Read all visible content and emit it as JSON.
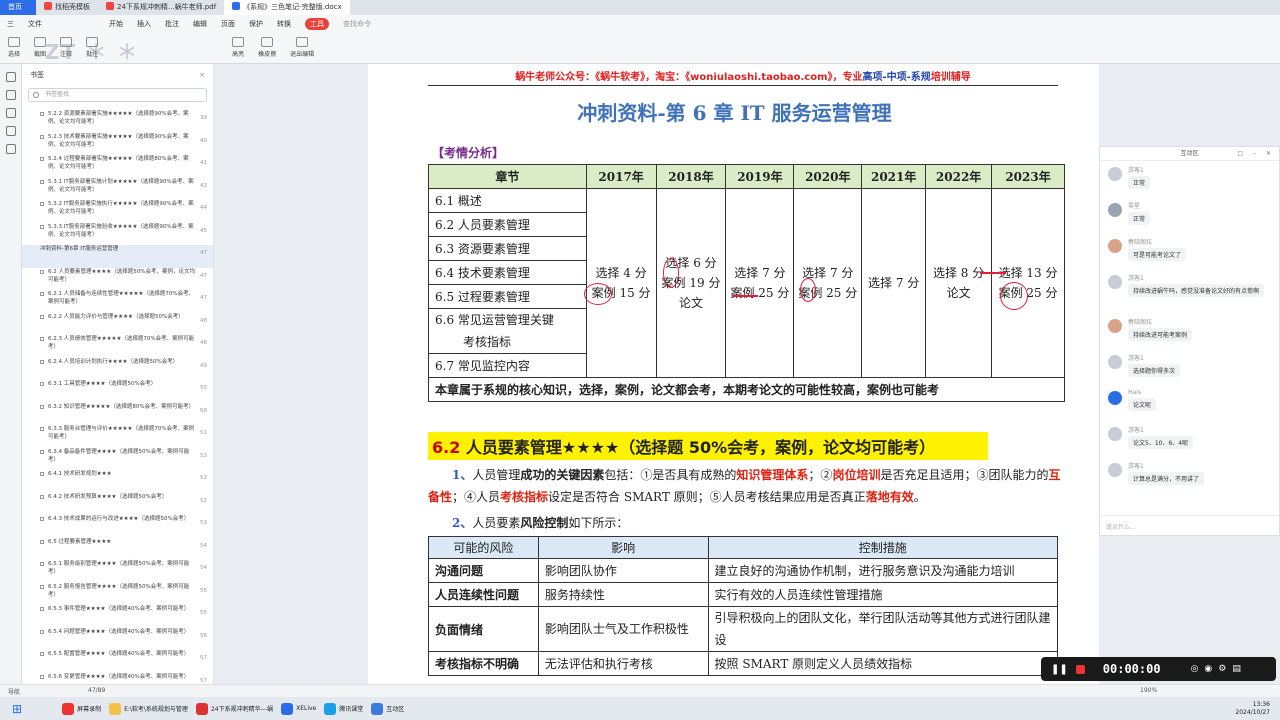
{
  "tabs": [
    "首页",
    "找稻壳模板",
    "24下系规冲刺精...蜗牛老师.pdf",
    "《系规》三色笔记-完整版.docx"
  ],
  "menu": [
    "三",
    "文件",
    "开始",
    "插入",
    "批注",
    "编辑",
    "页面",
    "保护",
    "转换",
    "工具"
  ],
  "menu_search": "查找命令",
  "ribbon": [
    "选择",
    "截图",
    "注释",
    "批注",
    "高亮",
    "橡皮擦",
    "退出编辑"
  ],
  "sidebar": {
    "title": "书签",
    "search_placeholder": "书签查找",
    "items": [
      {
        "label": "5.2.2 资源要素部署实施★★★★★（选择题90%会考、案例、论文均可能考）",
        "page": "39"
      },
      {
        "label": "5.2.3 技术要素部署实施★★★★★（选择题90%会考、案例、论文均可能考）",
        "page": "40"
      },
      {
        "label": "5.2.4 过程要素部署实施★★★★★（选择题80%会考、案例、论文均可能考）",
        "page": "41"
      },
      {
        "label": "5.3.1 IT服务部署实施计划★★★★★（选择题90%会考、案例、论文均可能考）",
        "page": "43"
      },
      {
        "label": "5.3.2 IT服务部署实施执行★★★★★（选择题90%会考、案例、论文均可能考）",
        "page": "44"
      },
      {
        "label": "5.3.3 IT服务部署实施验收★★★★★（选择题90%会考、案例、论文均可能考）",
        "page": "45"
      },
      {
        "label": "冲刺资料-第6章 IT服务运营管理",
        "page": "47",
        "active": true
      },
      {
        "label": "6.2 人员要素管理★★★★（选择题50%会考，案例，论文均可能考）",
        "page": "47"
      },
      {
        "label": "6.2.1 人员储备与连续性管理★★★★★（选择题70%会考、案例可能考）",
        "page": "47"
      },
      {
        "label": "6.2.2 人员能力评价与管理★★★★（选择题50%会考）",
        "page": "48"
      },
      {
        "label": "6.2.3 人员绩效管理★★★★★（选择题70%会考、案例可能考）",
        "page": "48"
      },
      {
        "label": "6.2.4 人员培训计划执行★★★★（选择题50%会考）",
        "page": "49"
      },
      {
        "label": "6.3.1 工具管理★★★★（选择题50%会考）",
        "page": "50"
      },
      {
        "label": "6.3.2 知识管理★★★★★（选择题80%会考、案例可能考）",
        "page": "50"
      },
      {
        "label": "6.3.3 服务台管理与评价★★★★★（选择题70%会考、案例可能考）",
        "page": "51"
      },
      {
        "label": "6.3.4 备品备件管理★★★★（选择题50%会考、案例可能考）",
        "page": "52"
      },
      {
        "label": "6.4.1 技术研发规划★★★",
        "page": "52"
      },
      {
        "label": "6.4.2 技术研发预算★★★★（选择题50%会考）",
        "page": "52"
      },
      {
        "label": "6.4.3 技术成果的运行与改进★★★★（选择题50%会考）",
        "page": "53"
      },
      {
        "label": "6.5 过程要素管理★★★★",
        "page": "54"
      },
      {
        "label": "6.5.1 服务级别管理★★★★（选择题50%会考、案例可能考）",
        "page": "54"
      },
      {
        "label": "6.5.2 服务报告管理★★★★（选择题50%会考、案例可能考）",
        "page": "55"
      },
      {
        "label": "6.5.3 事件管理★★★★（选择题40%会考、案例可能考）",
        "page": "55"
      },
      {
        "label": "6.5.4 问题管理★★★★（选择题40%会考、案例可能考）",
        "page": "56"
      },
      {
        "label": "6.5.5 配置管理★★★★（选择题40%会考、案例可能考）",
        "page": "57"
      },
      {
        "label": "6.5.6 变更管理★★★★（选择题40%会考、案例可能考）",
        "page": "57"
      }
    ]
  },
  "doc": {
    "header_red": "蜗牛老师公众号：《蜗牛软考》，淘宝：《woniulaoshi.taobao.com》，专业",
    "header_blue": "高项-中项-系规",
    "header_tail": "培训辅导",
    "title": "冲刺资料-第 6 章  IT 服务运营管理",
    "section_label": "【考情分析】",
    "table1": {
      "headers": [
        "章节",
        "2017年",
        "2018年",
        "2019年",
        "2020年",
        "2021年",
        "2022年",
        "2023年"
      ],
      "chapters": [
        "6.1 概述",
        "6.2 人员要素管理",
        "6.3 资源要素管理",
        "6.4 技术要素管理",
        "6.5 过程要素管理",
        "6.6 常见运营管理关键",
        "考核指标",
        "6.7 常见监控内容"
      ],
      "years": [
        [
          "选择 4 分",
          "案例 15 分"
        ],
        [
          "选择 6 分",
          "案例 19 分",
          "论文"
        ],
        [
          "选择 7 分",
          "案例 25 分"
        ],
        [
          "选择 7 分",
          "案例 25 分"
        ],
        [
          "选择 7 分"
        ],
        [
          "选择 8 分",
          "论文"
        ],
        [
          "选择 13 分",
          "案例 25 分"
        ]
      ],
      "footer": "本章属于系规的核心知识，选择，案例，论文都会考，本期考论文的可能性较高，案例也可能考"
    },
    "h62": {
      "num": "6.2",
      "text": " 人员要素管理★★★★（选择题 50%会考，案例，论文均可能考）"
    },
    "p1": {
      "idx": "1、",
      "a": "人员管理",
      "b": "成功的关键因素",
      "c": "包括：①是否具有成熟的",
      "d": "知识管理体系",
      "e": "；②",
      "f": "岗位培训",
      "g": "是否充足且适用；③团",
      "h": "队能力的",
      "i": "互备性",
      "j": "；④人员",
      "k": "考核指标",
      "l": "设定是否符合 SMART 原则；⑤人员考核结果应用是否真正",
      "m": "落地有效",
      "n": "。"
    },
    "p2": {
      "idx": "2、",
      "a": "人员要素",
      "b": "风险控制",
      "c": "如下所示："
    },
    "table2": {
      "headers": [
        "可能的风险",
        "影响",
        "控制措施"
      ],
      "rows": [
        {
          "risk": "沟通问题",
          "impact": "影响团队协作",
          "measure": "建立良好的沟通协作机制，进行服务意识及沟通能力培训"
        },
        {
          "risk": "人员连续性问题",
          "impact": "服务持续性",
          "measure": "实行有效的人员连续性管理措施"
        },
        {
          "risk": "负面情绪",
          "impact": "影响团队士气及工作积极性",
          "measure": "引导积极向上的团队文化，举行团队活动等其他方式进行团队建设"
        },
        {
          "risk": "考核指标不明确",
          "impact": "无法评估和执行考核",
          "measure": "按照 SMART 原则定义人员绩效指标"
        }
      ]
    }
  },
  "chat": {
    "title": "互动区",
    "messages": [
      {
        "name": "游客1",
        "text": "正常"
      },
      {
        "name": "零星",
        "text": "正常"
      },
      {
        "name": "春晓图拉",
        "text": "可是可能考论文了"
      },
      {
        "name": "游客1",
        "text": "持续改进蜗牛吗，感觉没准备论文好的有点慌啊"
      },
      {
        "name": "春晓图拉",
        "text": "持续改进可能考案例"
      },
      {
        "name": "游客1",
        "text": "选择题你得多次"
      },
      {
        "name": "Hais",
        "text": "论文呢"
      },
      {
        "name": "游客1",
        "text": "论文5、10、6、4呢"
      },
      {
        "name": "游客1",
        "text": "计算总是满分，不用讲了"
      }
    ],
    "input_placeholder": "说点什么..."
  },
  "status": {
    "left": "导航",
    "page": "47/89",
    "zoom": "190%"
  },
  "recorder": {
    "time": "00:00:00"
  },
  "taskbar": [
    "屏幕录制",
    "E:\\软考\\系统规划与管理",
    "24下系规冲刺精华---蜗",
    "XELive",
    "腾讯课堂",
    "互动区"
  ],
  "clock": {
    "time": "13:36",
    "date": "2024/10/27"
  }
}
